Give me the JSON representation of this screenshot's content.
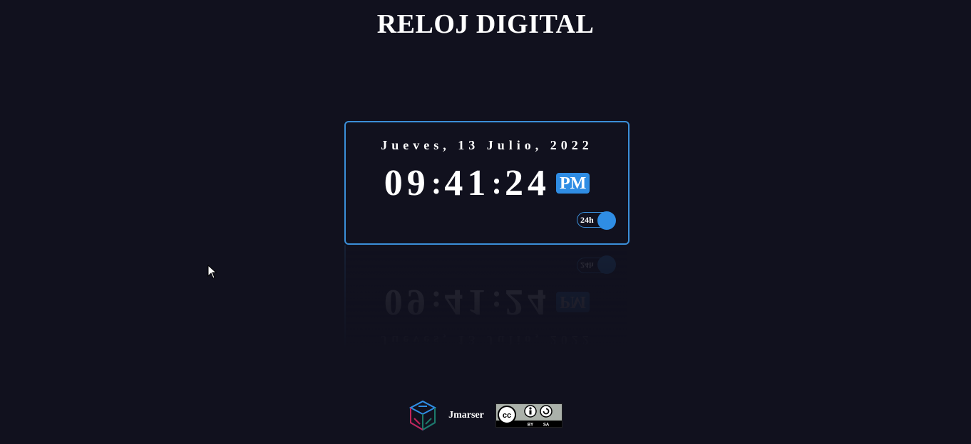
{
  "header": {
    "title": "RELOJ DIGITAL"
  },
  "clock": {
    "date": "Jueves, 13 Julio, 2022",
    "hours": "09",
    "minutes": "41",
    "seconds": "24",
    "separator": ":",
    "period": "PM",
    "toggle_label": "24h"
  },
  "footer": {
    "author": "Jmarser",
    "logo_icon": "cube-logo-icon",
    "license_icon": "cc-by-sa-badge"
  },
  "colors": {
    "background": "#11111e",
    "accent": "#2f8de4",
    "text": "#ffffff"
  }
}
